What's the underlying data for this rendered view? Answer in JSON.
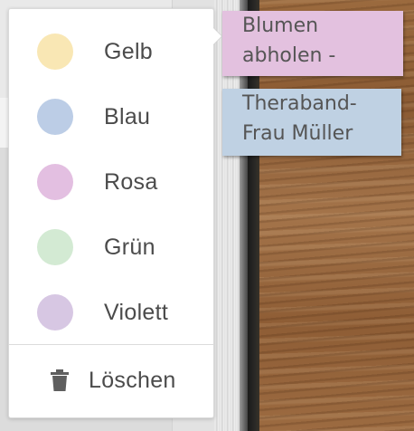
{
  "menu": {
    "colors": [
      {
        "label": "Gelb",
        "color": "#f9e7b4"
      },
      {
        "label": "Blau",
        "color": "#bccde6"
      },
      {
        "label": "Rosa",
        "color": "#e3bfe1"
      },
      {
        "label": "Grün",
        "color": "#d3ead3"
      },
      {
        "label": "Violett",
        "color": "#d7c7e3"
      }
    ],
    "delete_label": "Löschen",
    "delete_icon": "trash-icon"
  },
  "notes": [
    {
      "lines": [
        "Blumen",
        "abholen -"
      ],
      "color": "#e3c1df"
    },
    {
      "lines": [
        "Theraband-",
        "Frau Müller"
      ],
      "color": "#bfd1e3"
    }
  ]
}
